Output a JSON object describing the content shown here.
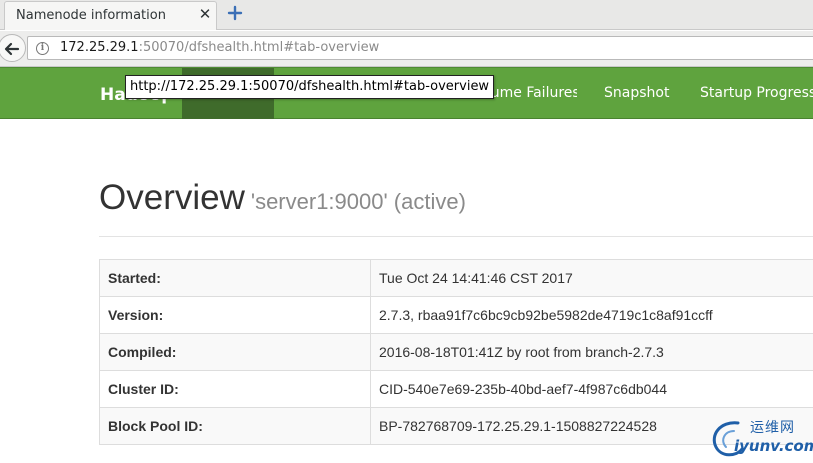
{
  "browser": {
    "tab_title": "Namenode information",
    "tab_close": "✕",
    "url_host": "172.25.29.1",
    "url_rest": ":50070/dfshealth.html#tab-overview",
    "tooltip": "http://172.25.29.1:50070/dfshealth.html#tab-overview"
  },
  "nav": {
    "brand": "Hadoop",
    "links": [
      "Datanode Volume Failures",
      "Snapshot",
      "Startup Progress"
    ]
  },
  "overview": {
    "title": "Overview",
    "subtitle": "'server1:9000' (active)"
  },
  "info_rows": [
    {
      "key": "Started:",
      "value": "Tue Oct 24 14:41:46 CST 2017"
    },
    {
      "key": "Version:",
      "value": "2.7.3, rbaa91f7c6bc9cb92be5982de4719c1c8af91ccff"
    },
    {
      "key": "Compiled:",
      "value": "2016-08-18T01:41Z by root from branch-2.7.3"
    },
    {
      "key": "Cluster ID:",
      "value": "CID-540e7e69-235b-40bd-aef7-4f987c6db044"
    },
    {
      "key": "Block Pool ID:",
      "value": "BP-782768709-172.25.29.1-1508827224528"
    }
  ],
  "watermark": {
    "cn": "运维网",
    "en": "iyunv.com"
  },
  "colors": {
    "navbar": "#5fa33e",
    "active_tab": "#3f6b2b",
    "watermark": "#1f5fa8"
  }
}
